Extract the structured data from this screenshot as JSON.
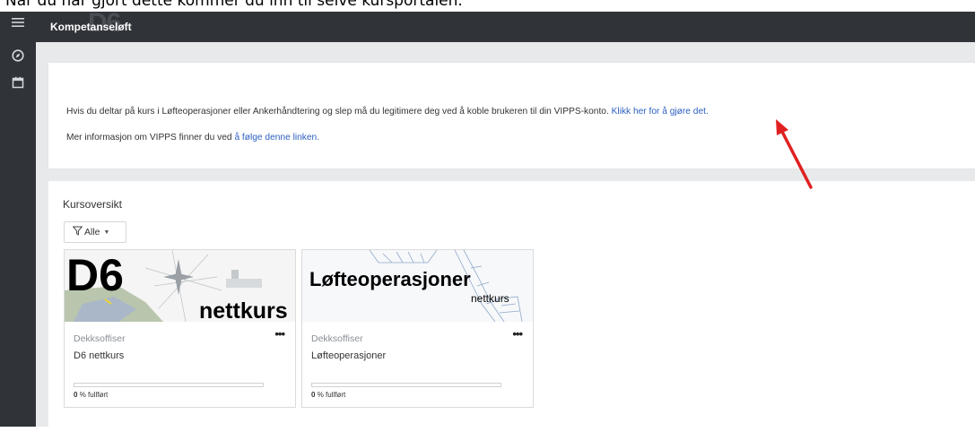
{
  "caption": "Når du har gjort dette kommer du inn til selve kursportalen.",
  "header": {
    "brand": "Kompetanseløft",
    "brand_logo_text": "D6"
  },
  "icons": {
    "menu": "hamburger-icon",
    "explore": "compass-icon",
    "calendar": "calendar-icon"
  },
  "info": {
    "line1_text": "Hvis du deltar på kurs i Løfteoperasjoner eller Ankerhåndtering og slep må du legitimere deg ved å koble brukeren til din VIPPS-konto.",
    "line1_link": "Klikk her for å gjøre det.",
    "line2_text": "Mer informasjon om VIPPS finner du ved",
    "line2_link": "å følge denne linken."
  },
  "courses_section": {
    "title": "Kursoversikt",
    "filter_label": "Alle",
    "courses": [
      {
        "thumb_title": "D6",
        "thumb_subtitle": "nettkurs",
        "category": "Dekksoffiser",
        "name": "D6 nettkurs",
        "progress_pct": "0",
        "progress_suffix": "% fullført",
        "progress_value": 0
      },
      {
        "thumb_title": "Løfteoperasjoner",
        "thumb_subtitle": "nettkurs",
        "category": "Dekksoffiser",
        "name": "Løfteoperasjoner",
        "progress_pct": "0",
        "progress_suffix": "% fullført",
        "progress_value": 0
      }
    ]
  },
  "colors": {
    "topbar": "#303439",
    "link": "#2c5fbf",
    "annotation_arrow": "#e02020",
    "background": "#e8e9eb"
  }
}
